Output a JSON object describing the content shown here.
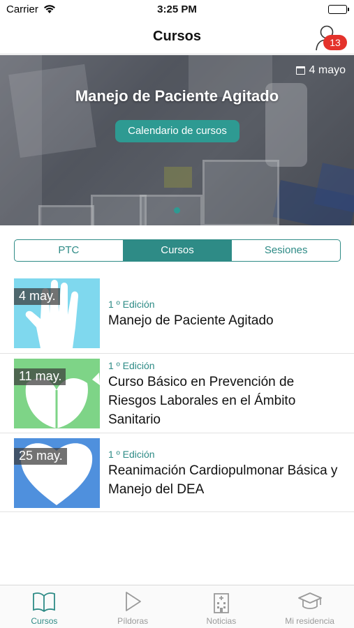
{
  "status_bar": {
    "carrier": "Carrier",
    "time": "3:25 PM"
  },
  "nav": {
    "title": "Cursos",
    "notifications_badge": "13"
  },
  "hero": {
    "date": "4 mayo",
    "title": "Manejo de Paciente Agitado",
    "button_label": "Calendario de cursos"
  },
  "segments": [
    {
      "label": "PTC",
      "active": false
    },
    {
      "label": "Cursos",
      "active": true
    },
    {
      "label": "Sesiones",
      "active": false
    }
  ],
  "courses": [
    {
      "date": "4 may.",
      "edition": "1 º Edición",
      "name": "Manejo de Paciente Agitado",
      "icon": "hand-icon",
      "color": "#7fd8ee"
    },
    {
      "date": "11 may.",
      "edition": "1 º Edición",
      "name": "Curso Básico en Prevención de Riesgos Laborales en el Ámbito Sanitario",
      "icon": "shield-leaf-icon",
      "color": "#7ed487"
    },
    {
      "date": "25 may.",
      "edition": "1 º Edición",
      "name": "Reanimación Cardiopulmonar Básica y Manejo del DEA",
      "icon": "heart-icon",
      "color": "#4f90dd"
    }
  ],
  "tabbar": [
    {
      "label": "Cursos",
      "icon": "book-icon",
      "active": true
    },
    {
      "label": "Píldoras",
      "icon": "play-icon",
      "active": false
    },
    {
      "label": "Noticias",
      "icon": "hospital-icon",
      "active": false
    },
    {
      "label": "Mi residencia",
      "icon": "graduation-cap-icon",
      "active": false
    }
  ],
  "colors": {
    "accent": "#2e8b86",
    "badge": "#e4322b"
  }
}
